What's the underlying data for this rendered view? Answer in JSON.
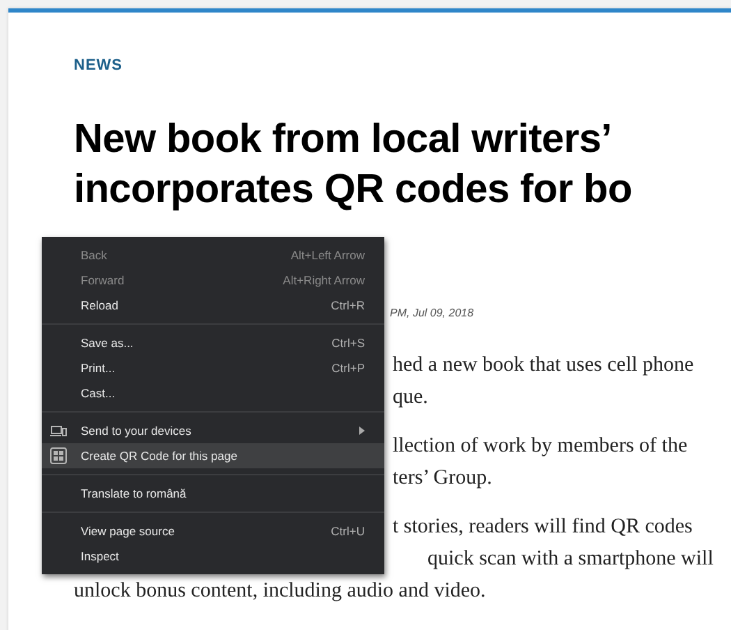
{
  "article": {
    "section": "NEWS",
    "headline": [
      "New book from local writers’",
      "incorporates QR codes for bo"
    ],
    "byline": "PM, Jul 09, 2018",
    "paragraphs": [
      {
        "lines": [
          "hed a new book that uses cell phone",
          "que."
        ]
      },
      {
        "lines": [
          "llection of work by members of the",
          "ters’ Group."
        ]
      },
      {
        "lines": [
          "t stories, readers will find QR codes",
          "quick scan with a smartphone will",
          "unlock bonus content, including audio and video."
        ]
      }
    ]
  },
  "context_menu": {
    "groups": [
      {
        "items": [
          {
            "label": "Back",
            "shortcut": "Alt+Left Arrow",
            "disabled": true,
            "selected": false,
            "kind": "plain"
          },
          {
            "label": "Forward",
            "shortcut": "Alt+Right Arrow",
            "disabled": true,
            "selected": false,
            "kind": "plain"
          },
          {
            "label": "Reload",
            "shortcut": "Ctrl+R",
            "disabled": false,
            "selected": false,
            "kind": "plain"
          }
        ]
      },
      {
        "items": [
          {
            "label": "Save as...",
            "shortcut": "Ctrl+S",
            "disabled": false,
            "selected": false,
            "kind": "plain"
          },
          {
            "label": "Print...",
            "shortcut": "Ctrl+P",
            "disabled": false,
            "selected": false,
            "kind": "plain"
          },
          {
            "label": "Cast...",
            "disabled": false,
            "selected": false,
            "kind": "plain"
          }
        ]
      },
      {
        "items": [
          {
            "label": "Send to your devices",
            "disabled": false,
            "selected": false,
            "kind": "devices",
            "submenu": true
          },
          {
            "label": "Create QR Code for this page",
            "disabled": false,
            "selected": true,
            "kind": "qr"
          }
        ]
      },
      {
        "items": [
          {
            "label": "Translate to română",
            "disabled": false,
            "selected": false,
            "kind": "plain"
          }
        ]
      },
      {
        "items": [
          {
            "label": "View page source",
            "shortcut": "Ctrl+U",
            "disabled": false,
            "selected": false,
            "kind": "plain"
          },
          {
            "label": "Inspect",
            "disabled": false,
            "selected": false,
            "kind": "plain"
          }
        ]
      }
    ]
  }
}
